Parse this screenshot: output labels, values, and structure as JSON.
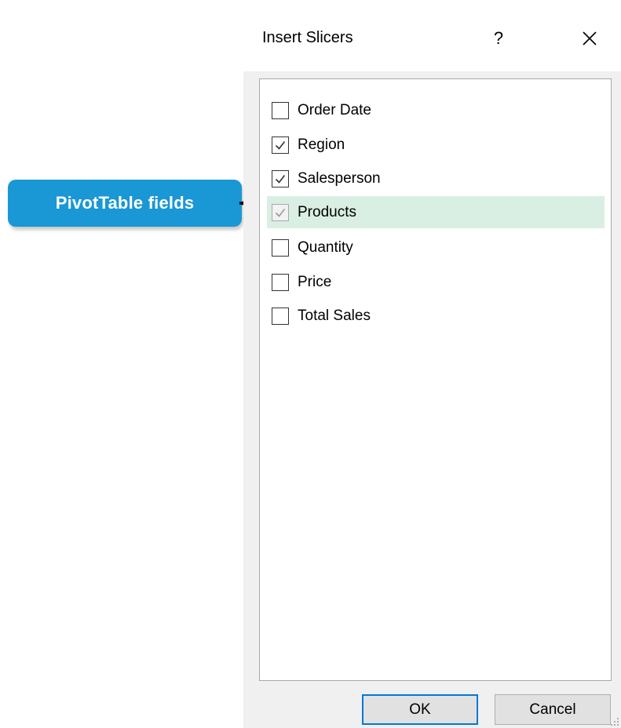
{
  "annotation": {
    "callout_label": "PivotTable fields",
    "callout_color": "#1a97d5"
  },
  "dialog": {
    "title": "Insert Slicers",
    "help_glyph": "?",
    "close_icon": "close-icon",
    "fields": [
      {
        "label": "Order Date",
        "checked": false,
        "disabled": false,
        "highlighted": false
      },
      {
        "label": "Region",
        "checked": true,
        "disabled": false,
        "highlighted": false
      },
      {
        "label": "Salesperson",
        "checked": true,
        "disabled": false,
        "highlighted": false
      },
      {
        "label": "Products",
        "checked": true,
        "disabled": true,
        "highlighted": true
      },
      {
        "label": "Quantity",
        "checked": false,
        "disabled": false,
        "highlighted": false
      },
      {
        "label": "Price",
        "checked": false,
        "disabled": false,
        "highlighted": false
      },
      {
        "label": "Total Sales",
        "checked": false,
        "disabled": false,
        "highlighted": false
      }
    ],
    "highlight_color": "#d9efe3",
    "buttons": {
      "ok_label": "OK",
      "cancel_label": "Cancel"
    }
  }
}
